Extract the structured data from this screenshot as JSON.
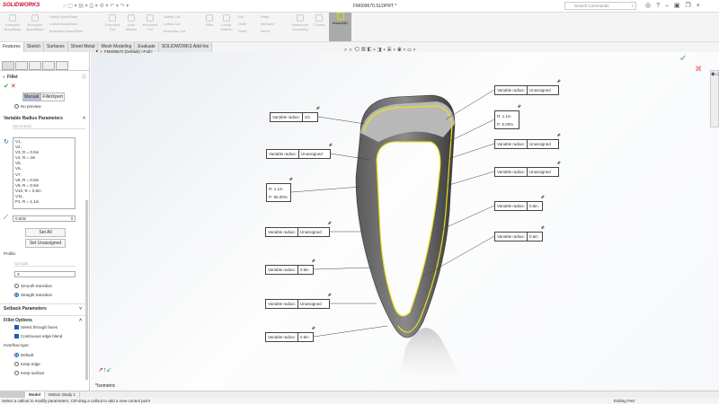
{
  "app": {
    "brand": "SOLIDWORKS",
    "doc_title": "FM009670.SLDPRT *",
    "search_placeholder": "Search Commands"
  },
  "ribbon": {
    "items": [
      "Extruded Boss/Base",
      "Revolved Boss/Base",
      "Swept Boss/Base",
      "Lofted Boss/Base",
      "Boundary Boss/Base",
      "Extruded Cut",
      "Hole Wizard",
      "Revolved Cut",
      "Swept Cut",
      "Lofted Cut",
      "Boundary Cut",
      "Fillet",
      "Linear Pattern",
      "Rib",
      "Draft",
      "Shell",
      "Wrap",
      "Intersect",
      "Mirror",
      "Reference Geometry",
      "Curves",
      "Instant3D"
    ]
  },
  "tabs": [
    "Features",
    "Sketch",
    "Surfaces",
    "Sheet Metal",
    "Mesh Modeling",
    "Evaluate",
    "SOLIDWORKS Add-Ins"
  ],
  "tree": {
    "root": "FM009670 (Default) <Full>"
  },
  "panel": {
    "title": "Fillet",
    "manual": "Manual",
    "filletxpert": "FilletXpert",
    "no_preview": "No preview",
    "vr_section": "Variable Radius Parameters",
    "symmetric": "Symmetric",
    "vertices": [
      "V1,",
      "V2,",
      "V3, R = 0.5in",
      "V4, R = 2in",
      "V5,",
      "V6,",
      "V7,",
      "V8, R = 0.5in",
      "V9, R = 0.5in",
      "V10, R = 0.5in",
      "V11,",
      "P1, R = 1.1in"
    ],
    "radius_value": "0.50in",
    "set_all": "Set All",
    "set_unassigned": "Set Unassigned",
    "profile_label": "Profile:",
    "profile_value": "Circular",
    "instances": "3",
    "smooth": "Smooth transition",
    "straight": "Straight transition",
    "setback": "Setback Parameters",
    "fillet_options": "Fillet Options",
    "select_through": "Select through faces",
    "continuous": "Continuous edge blend",
    "overflow": "Overflow type:",
    "default": "Default",
    "keep_edge": "Keep edge",
    "keep_surface": "Keep surface"
  },
  "viewport": {
    "view_label": "*Isometric",
    "callouts": [
      {
        "label": "Variable radius:",
        "value": "2in"
      },
      {
        "label": "Variable radius:",
        "value": "Unassigned"
      },
      {
        "r": "R: 1.1in",
        "p": "P: 95.00%"
      },
      {
        "label": "Variable radius:",
        "value": "Unassigned"
      },
      {
        "label": "Variable radius:",
        "value": "0.5in"
      },
      {
        "label": "Variable radius:",
        "value": "Unassigned"
      },
      {
        "label": "Variable radius:",
        "value": "0.5in"
      },
      {
        "label": "Variable radius:",
        "value": "Unassigned"
      },
      {
        "r": "R: 1.1in",
        "p": "P: 5.00%"
      },
      {
        "label": "Variable radius:",
        "value": "Unassigned"
      },
      {
        "label": "Variable radius:",
        "value": "Unassigned"
      },
      {
        "label": "Variable radius:",
        "value": "0.5in"
      },
      {
        "label": "Variable radius:",
        "value": "0.5in"
      }
    ]
  },
  "bottom_tabs": [
    "Model",
    "Motion Study 1"
  ],
  "status": {
    "message": "Select a callout to modify parameters, Ctrl-drag a callout to add a new control point",
    "mode": "Editing Part"
  },
  "colors": {
    "accent": "#1a5fb4",
    "edge": "#e8e020",
    "brand": "#c8102e"
  }
}
